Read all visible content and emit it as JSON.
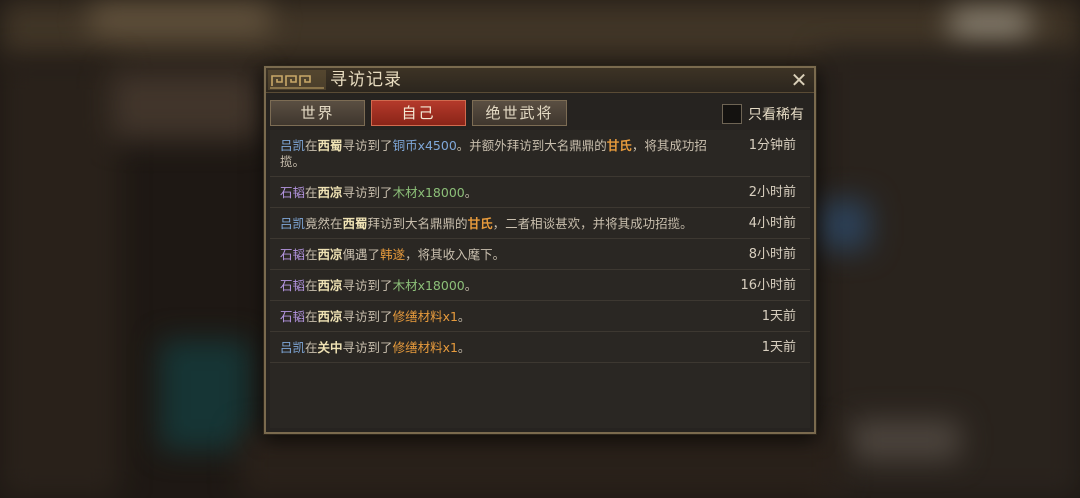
{
  "dialog": {
    "title": "寻访记录",
    "close_label": "✕",
    "tabs": [
      {
        "label": "世界",
        "active": false
      },
      {
        "label": "自己",
        "active": true
      },
      {
        "label": "绝世武将",
        "active": false
      }
    ],
    "rare_only_label": "只看稀有",
    "rare_only_checked": false
  },
  "records": [
    {
      "parts": [
        {
          "t": "吕凯",
          "c": "p"
        },
        {
          "t": "在",
          "c": ""
        },
        {
          "t": "西蜀",
          "c": "loc"
        },
        {
          "t": "寻访到了",
          "c": ""
        },
        {
          "t": "铜币x4500",
          "c": "item-b"
        },
        {
          "t": "。并额外拜访到大名鼎鼎的",
          "c": ""
        },
        {
          "t": "甘氏",
          "c": "hero-b"
        },
        {
          "t": "，将其成功招揽。",
          "c": ""
        }
      ],
      "time": "1分钟前"
    },
    {
      "parts": [
        {
          "t": "石韬",
          "c": "p2"
        },
        {
          "t": "在",
          "c": ""
        },
        {
          "t": "西凉",
          "c": "loc"
        },
        {
          "t": "寻访到了",
          "c": ""
        },
        {
          "t": "木材x18000",
          "c": "item-g"
        },
        {
          "t": "。",
          "c": ""
        }
      ],
      "time": "2小时前"
    },
    {
      "parts": [
        {
          "t": "吕凯",
          "c": "p"
        },
        {
          "t": "竟然在",
          "c": ""
        },
        {
          "t": "西蜀",
          "c": "loc"
        },
        {
          "t": "拜访到大名鼎鼎的",
          "c": ""
        },
        {
          "t": "甘氏",
          "c": "hero-b"
        },
        {
          "t": "，二者相谈甚欢，并将其成功招揽。",
          "c": ""
        }
      ],
      "time": "4小时前"
    },
    {
      "parts": [
        {
          "t": "石韬",
          "c": "p2"
        },
        {
          "t": "在",
          "c": ""
        },
        {
          "t": "西凉",
          "c": "loc"
        },
        {
          "t": "偶遇了",
          "c": ""
        },
        {
          "t": "韩遂",
          "c": "hero"
        },
        {
          "t": "，将其收入麾下。",
          "c": ""
        }
      ],
      "time": "8小时前"
    },
    {
      "parts": [
        {
          "t": "石韬",
          "c": "p2"
        },
        {
          "t": "在",
          "c": ""
        },
        {
          "t": "西凉",
          "c": "loc"
        },
        {
          "t": "寻访到了",
          "c": ""
        },
        {
          "t": "木材x18000",
          "c": "item-g"
        },
        {
          "t": "。",
          "c": ""
        }
      ],
      "time": "16小时前"
    },
    {
      "parts": [
        {
          "t": "石韬",
          "c": "p2"
        },
        {
          "t": "在",
          "c": ""
        },
        {
          "t": "西凉",
          "c": "loc"
        },
        {
          "t": "寻访到了",
          "c": ""
        },
        {
          "t": "修缮材料x1",
          "c": "item-o"
        },
        {
          "t": "。",
          "c": ""
        }
      ],
      "time": "1天前"
    },
    {
      "parts": [
        {
          "t": "吕凯",
          "c": "p"
        },
        {
          "t": "在",
          "c": ""
        },
        {
          "t": "关中",
          "c": "loc"
        },
        {
          "t": "寻访到了",
          "c": ""
        },
        {
          "t": "修缮材料x1",
          "c": "item-o"
        },
        {
          "t": "。",
          "c": ""
        }
      ],
      "time": "1天前"
    }
  ],
  "colors": {
    "accent_red": "#b43a2b",
    "player_blue": "#7fa7d8",
    "player_purple": "#b495e0",
    "item_orange": "#e69a3c",
    "item_green": "#8cbf78"
  }
}
